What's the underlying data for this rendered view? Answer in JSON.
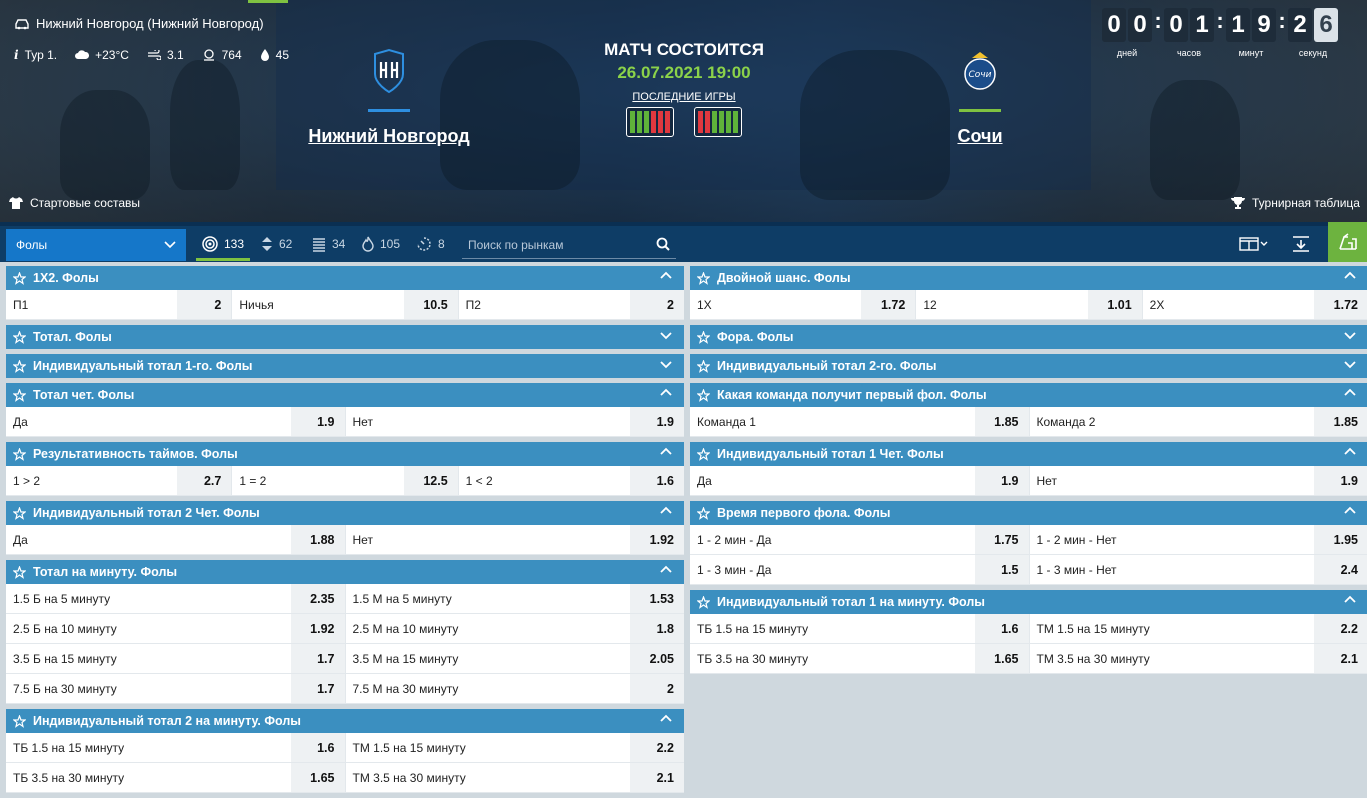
{
  "hero": {
    "location": "Нижний Новгород (Нижний Новгород)",
    "round": "Тур 1.",
    "temperature": "+23°C",
    "wind": "3.1",
    "pressure": "764",
    "humidity": "45",
    "lineups_label": "Стартовые составы",
    "standings_label": "Турнирная таблица",
    "status": "МАТЧ СОСТОИТСЯ",
    "datetime": "26.07.2021 19:00",
    "last_games_label": "ПОСЛЕДНИЕ ИГРЫ",
    "home": {
      "name": "Нижний Новгород",
      "color": "#2e8fe0"
    },
    "away": {
      "name": "Сочи",
      "color": "#7fc241"
    },
    "home_form": [
      "W",
      "W",
      "W",
      "L",
      "L",
      "L"
    ],
    "away_form": [
      "L",
      "L",
      "W",
      "W",
      "W",
      "W"
    ],
    "countdown": {
      "days": [
        "0",
        "0"
      ],
      "hours": [
        "0",
        "1"
      ],
      "minutes": [
        "1",
        "9"
      ],
      "seconds": [
        "2",
        "6"
      ],
      "days_label": "дней",
      "hours_label": "часов",
      "minutes_label": "минут",
      "seconds_label": "секунд"
    }
  },
  "toolbar": {
    "selected_market": "Фолы",
    "counts": [
      "133",
      "62",
      "34",
      "105",
      "8"
    ],
    "search_placeholder": "Поиск по рынкам"
  },
  "left_markets": [
    {
      "title": "1X2. Фолы",
      "open": true,
      "rows": [
        [
          [
            "П1",
            "2"
          ],
          [
            "Ничья",
            "10.5"
          ],
          [
            "П2",
            "2"
          ]
        ]
      ]
    },
    {
      "title": "Тотал. Фолы",
      "open": false,
      "rows": []
    },
    {
      "title": "Индивидуальный тотал 1-го. Фолы",
      "open": false,
      "rows": []
    },
    {
      "title": "Тотал чет. Фолы",
      "open": true,
      "rows": [
        [
          [
            "Да",
            "1.9"
          ],
          [
            "Нет",
            "1.9"
          ]
        ]
      ]
    },
    {
      "title": "Результативность таймов. Фолы",
      "open": true,
      "rows": [
        [
          [
            "1 > 2",
            "2.7"
          ],
          [
            "1 = 2",
            "12.5"
          ],
          [
            "1 < 2",
            "1.6"
          ]
        ]
      ]
    },
    {
      "title": "Индивидуальный тотал 2 Чет. Фолы",
      "open": true,
      "rows": [
        [
          [
            "Да",
            "1.88"
          ],
          [
            "Нет",
            "1.92"
          ]
        ]
      ]
    },
    {
      "title": "Тотал на минуту. Фолы",
      "open": true,
      "rows": [
        [
          [
            "1.5 Б на 5 минуту",
            "2.35"
          ],
          [
            "1.5 М на 5 минуту",
            "1.53"
          ]
        ],
        [
          [
            "2.5 Б на 10 минуту",
            "1.92"
          ],
          [
            "2.5 М на 10 минуту",
            "1.8"
          ]
        ],
        [
          [
            "3.5 Б на 15 минуту",
            "1.7"
          ],
          [
            "3.5 М на 15 минуту",
            "2.05"
          ]
        ],
        [
          [
            "7.5 Б на 30 минуту",
            "1.7"
          ],
          [
            "7.5 М на 30 минуту",
            "2"
          ]
        ]
      ]
    },
    {
      "title": "Индивидуальный тотал 2 на минуту. Фолы",
      "open": true,
      "rows": [
        [
          [
            "ТБ 1.5 на 15 минуту",
            "1.6"
          ],
          [
            "ТМ 1.5 на 15 минуту",
            "2.2"
          ]
        ],
        [
          [
            "ТБ 3.5 на 30 минуту",
            "1.65"
          ],
          [
            "ТМ 3.5 на 30 минуту",
            "2.1"
          ]
        ]
      ]
    }
  ],
  "right_markets": [
    {
      "title": "Двойной шанс. Фолы",
      "open": true,
      "rows": [
        [
          [
            "1Х",
            "1.72"
          ],
          [
            "12",
            "1.01"
          ],
          [
            "2Х",
            "1.72"
          ]
        ]
      ]
    },
    {
      "title": "Фора. Фолы",
      "open": false,
      "rows": []
    },
    {
      "title": "Индивидуальный тотал 2-го. Фолы",
      "open": false,
      "rows": []
    },
    {
      "title": "Какая команда получит первый фол. Фолы",
      "open": true,
      "rows": [
        [
          [
            "Команда 1",
            "1.85"
          ],
          [
            "Команда 2",
            "1.85"
          ]
        ]
      ]
    },
    {
      "title": "Индивидуальный тотал 1 Чет. Фолы",
      "open": true,
      "rows": [
        [
          [
            "Да",
            "1.9"
          ],
          [
            "Нет",
            "1.9"
          ]
        ]
      ]
    },
    {
      "title": "Время первого фола. Фолы",
      "open": true,
      "rows": [
        [
          [
            "1 - 2 мин - Да",
            "1.75"
          ],
          [
            "1 - 2 мин - Нет",
            "1.95"
          ]
        ],
        [
          [
            "1 - 3 мин - Да",
            "1.5"
          ],
          [
            "1 - 3 мин - Нет",
            "2.4"
          ]
        ]
      ]
    },
    {
      "title": "Индивидуальный тотал 1 на минуту. Фолы",
      "open": true,
      "rows": [
        [
          [
            "ТБ 1.5 на 15 минуту",
            "1.6"
          ],
          [
            "ТМ 1.5 на 15 минуту",
            "2.2"
          ]
        ],
        [
          [
            "ТБ 3.5 на 30 минуту",
            "1.65"
          ],
          [
            "ТМ 3.5 на 30 минуту",
            "2.1"
          ]
        ]
      ]
    }
  ]
}
